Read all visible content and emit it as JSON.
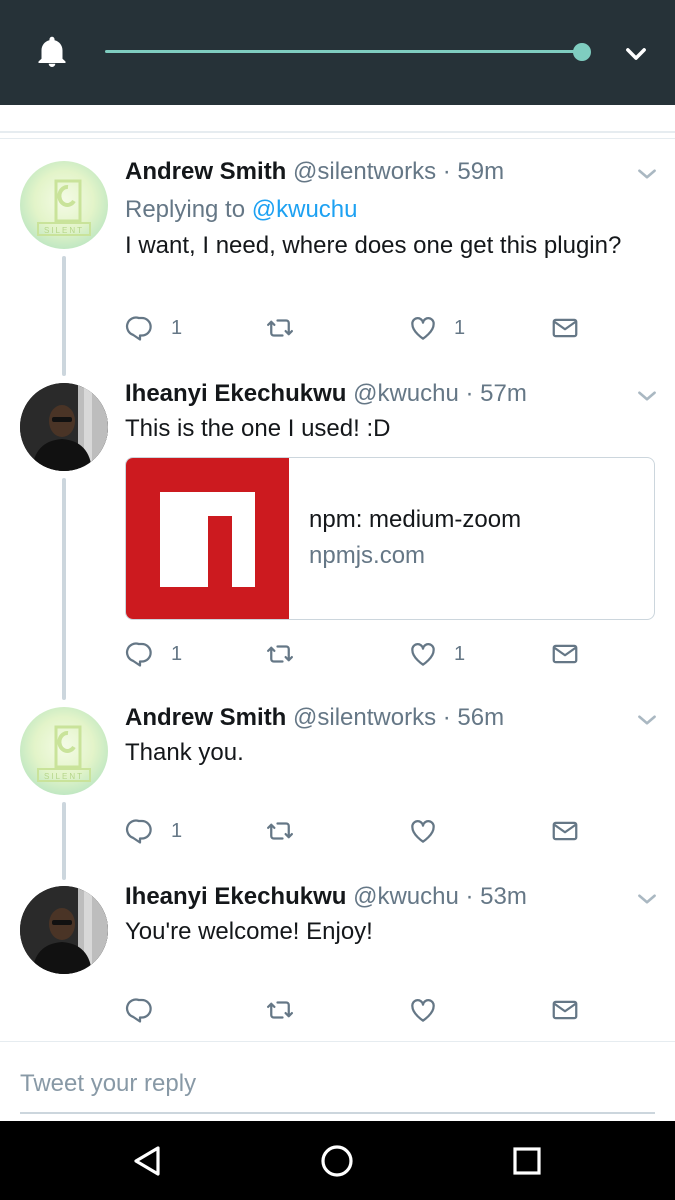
{
  "reply_box": {
    "placeholder": "Tweet your reply"
  },
  "media_bar": {
    "progress": 1.0
  },
  "colors": {
    "accent": "#7fcdc0",
    "link": "#1da1f2",
    "muted": "#657786",
    "card_brand": "#cc1a1f"
  },
  "tweets": [
    {
      "name": "Andrew Smith",
      "handle": "@silentworks",
      "time": "· 59m",
      "reply_prefix": "Replying to ",
      "reply_handle": "@kwuchu",
      "text": "I want, I need, where does one get this plugin?",
      "reply_count": "1",
      "like_count": "1"
    },
    {
      "name": "Iheanyi Ekechukwu",
      "handle": "@kwuchu",
      "time": "· 57m",
      "text": "This is the one I used! :D",
      "reply_count": "1",
      "like_count": "1",
      "card": {
        "title": "npm: medium-zoom",
        "domain": "npmjs.com"
      }
    },
    {
      "name": "Andrew Smith",
      "handle": "@silentworks",
      "time": "· 56m",
      "text": "Thank you.",
      "reply_count": "1",
      "like_count": ""
    },
    {
      "name": "Iheanyi Ekechukwu",
      "handle": "@kwuchu",
      "time": "· 53m",
      "text": "You're welcome! Enjoy!",
      "reply_count": "",
      "like_count": ""
    }
  ],
  "icons": {
    "bell": "bell-icon",
    "chevron": "chevron-down-icon",
    "reply": "reply-icon",
    "retweet": "retweet-icon",
    "like": "heart-icon",
    "dm": "envelope-icon",
    "back": "back-triangle-icon",
    "home": "home-circle-icon",
    "recents": "recents-square-icon"
  }
}
